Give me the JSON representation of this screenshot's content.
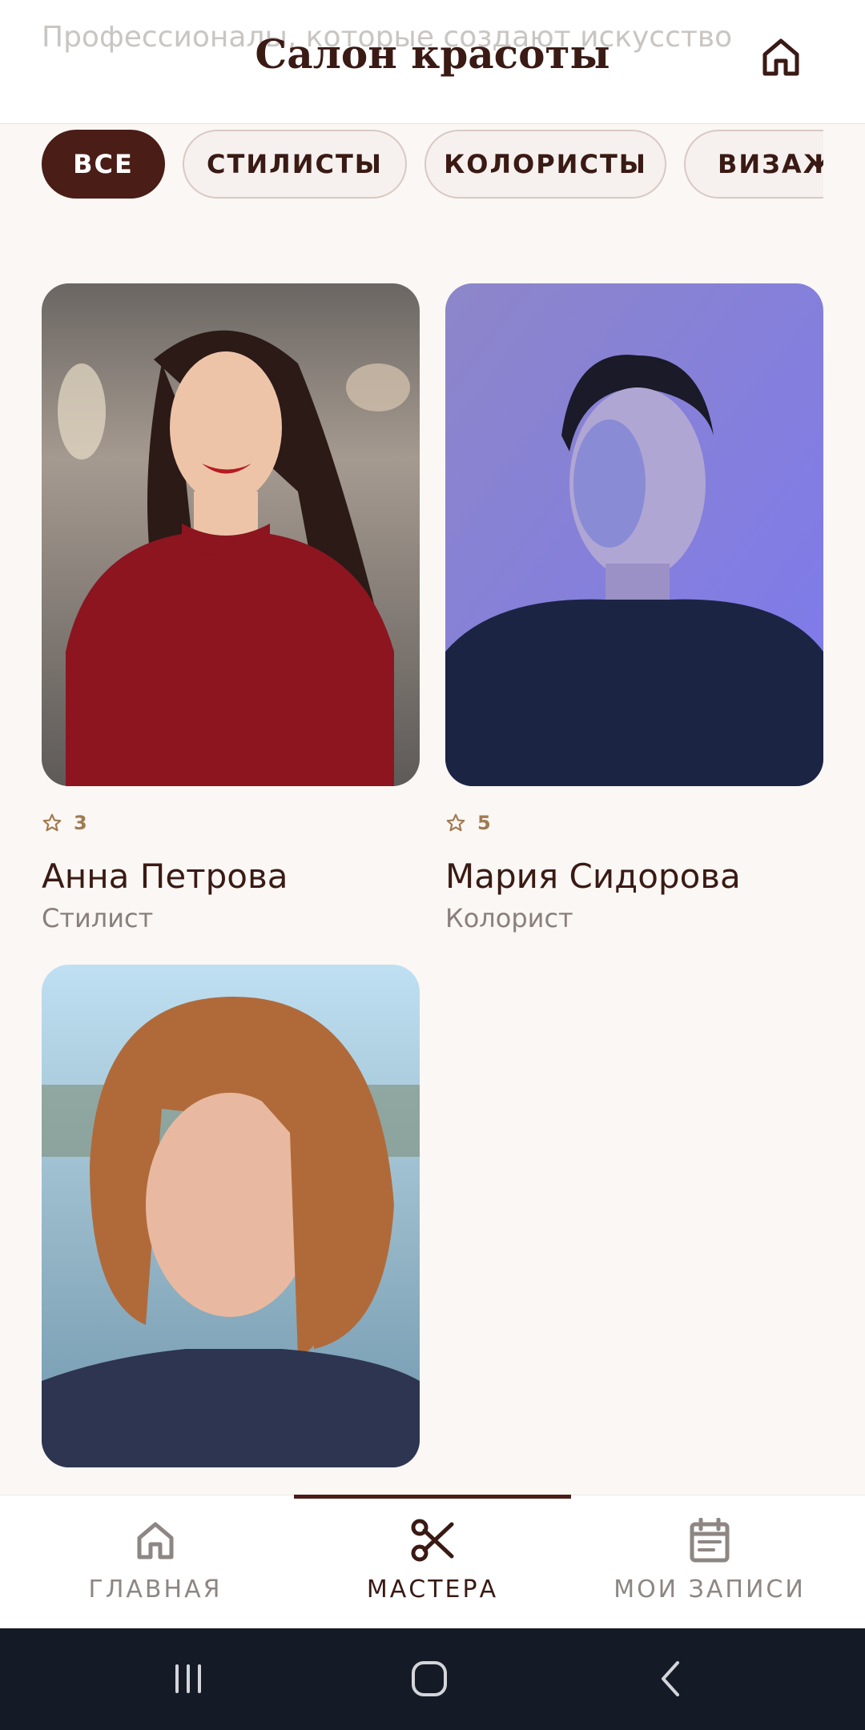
{
  "header": {
    "title": "Салон красоты",
    "subtitle": "Профессионалы, которые создают искусство"
  },
  "filters": [
    "ВСЕ",
    "СТИЛИСТЫ",
    "КОЛОРИСТЫ",
    "ВИЗАЖИ"
  ],
  "active_filter": "ВСЕ",
  "masters": [
    {
      "rating": "3",
      "name": "Анна Петрова",
      "role": "Стилист"
    },
    {
      "rating": "5",
      "name": "Мария Сидорова",
      "role": "Колорист"
    },
    {
      "rating": "",
      "name": "",
      "role": ""
    }
  ],
  "bottom_nav": {
    "items": [
      {
        "label": "ГЛАВНАЯ",
        "icon": "home-icon"
      },
      {
        "label": "МАСТЕРА",
        "icon": "scissors-icon"
      },
      {
        "label": "МОИ ЗАПИСИ",
        "icon": "calendar-icon"
      }
    ],
    "active": "МАСТЕРА"
  },
  "system_nav": {
    "icons": [
      "recent-apps-icon",
      "home-circle-icon",
      "back-icon"
    ]
  },
  "colors": {
    "primary": "#4a1d17",
    "background": "#faf7f4",
    "accent_star": "#a07a52",
    "system_bar": "#151b26"
  }
}
